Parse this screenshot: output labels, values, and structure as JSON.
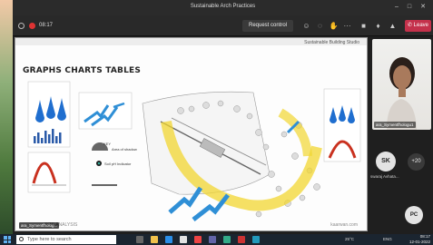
{
  "window": {
    "title": "Sustainable Arch Practices",
    "minimize_icon": "minimize-icon",
    "close_icon": "close-icon"
  },
  "meeting": {
    "timer": "08:17",
    "request_control_label": "Request control",
    "leave_label": "Leave",
    "toolbar_icons": [
      "people-icon",
      "chat-icon",
      "raise-hand-icon",
      "reactions-icon",
      "more-icon",
      "camera-icon",
      "mic-icon",
      "share-icon"
    ]
  },
  "slide": {
    "study_label": "Sustainable Building Studio",
    "heading": "GRAPHS CHARTS TABLES",
    "footer_left": "SITE ANALYSIS",
    "footer_right": "kaarwan.com",
    "presenter_tag": "ara_Symentfholog...",
    "key_title": "KEY",
    "key_shadow": "Area of shadow",
    "key_soil": "Soil pH Indicator"
  },
  "participants": {
    "video_name": "ara_Symentfhologu1",
    "sk_initials": "SK",
    "sk_name": "swaraj Avhata...",
    "more_count": "+20",
    "pc_initials": "PC"
  },
  "taskbar": {
    "search_placeholder": "Type here to search",
    "temperature": "25°C",
    "language": "ENG",
    "time": "08:17",
    "date": "12-01-2022"
  },
  "colors": {
    "leave": "#c4314b",
    "water_blue": "#1f6ecf",
    "shadow_yellow": "#f1d530",
    "wind_blue": "#2f8fd6",
    "temp_red": "#c9311f"
  }
}
